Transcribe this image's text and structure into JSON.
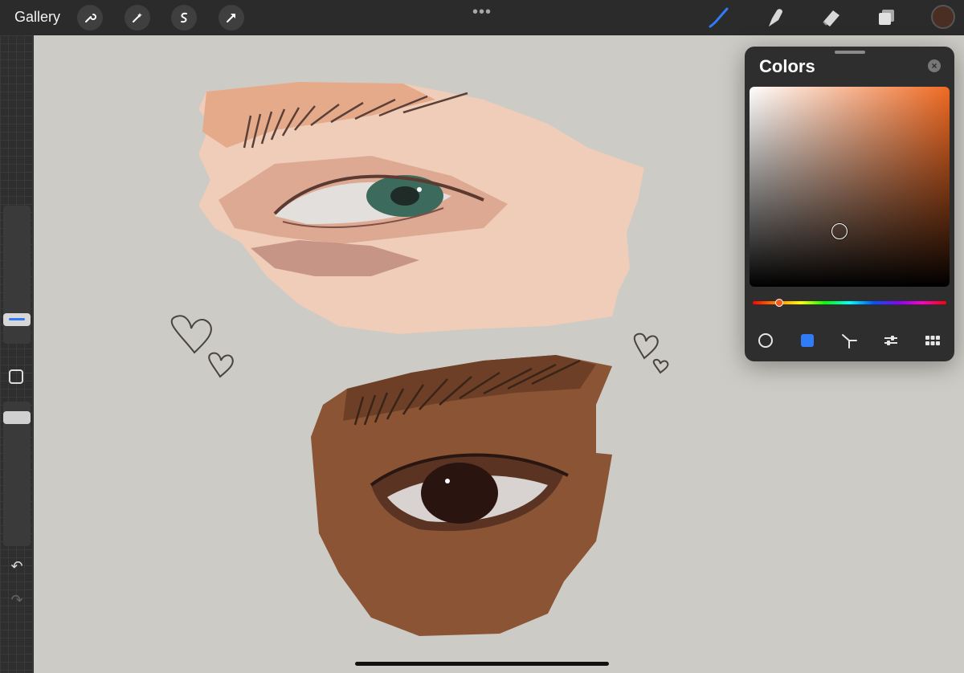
{
  "topbar": {
    "gallery_label": "Gallery",
    "left_tools": [
      "wrench-icon",
      "magic-wand-icon",
      "selection-icon",
      "transform-arrow-icon"
    ],
    "center_menu": "•••",
    "right_tools": [
      "brush-icon",
      "smudge-icon",
      "eraser-icon",
      "layers-icon"
    ],
    "active_tool": "brush",
    "accent_color": "#2f7cf6",
    "current_color": "#4a2e22"
  },
  "sidebar": {
    "buttons": [
      "brush-size-slider",
      "modify-button",
      "opacity-slider",
      "undo-icon",
      "redo-icon"
    ],
    "undo_glyph": "↶",
    "redo_glyph": "↷"
  },
  "colors_panel": {
    "title": "Colors",
    "close_glyph": "×",
    "hue_color": "#f06a23",
    "tabs": [
      "disc-tab",
      "classic-tab",
      "harmony-tab",
      "value-tab",
      "palettes-tab"
    ],
    "active_tab": "classic-tab"
  },
  "canvas": {
    "background": "#cdcbc5",
    "subject": [
      "light-skin-eye-study",
      "dark-skin-eye-study",
      "heart-doodles"
    ]
  }
}
